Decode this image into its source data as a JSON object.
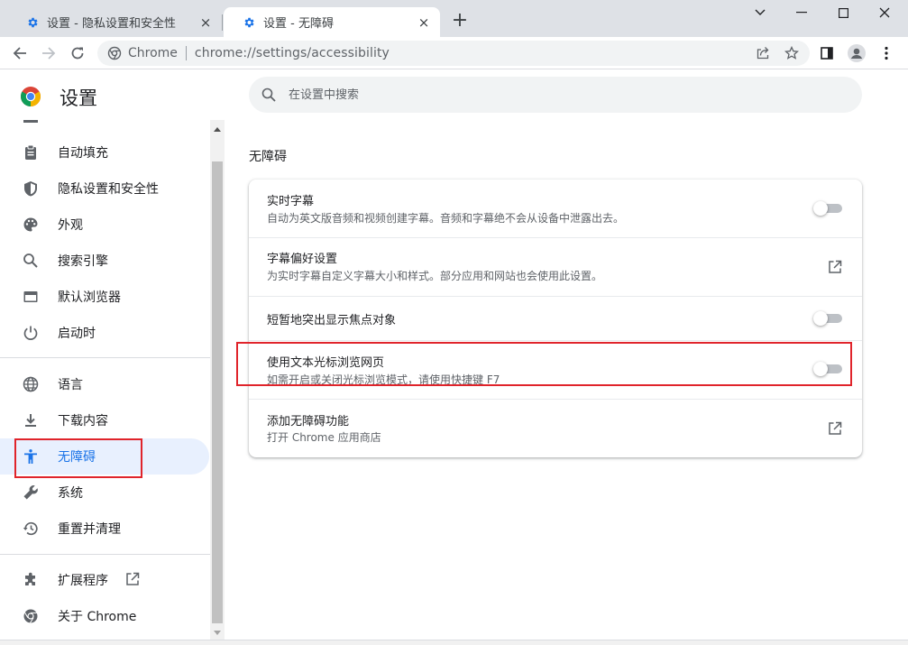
{
  "tabs": [
    {
      "title": "设置 - 隐私设置和安全性",
      "close": "×"
    },
    {
      "title": "设置 - 无障碍",
      "close": "×"
    }
  ],
  "new_tab": "+",
  "omnibox": {
    "chip": "Chrome",
    "url": "chrome://settings/accessibility"
  },
  "header": {
    "title": "设置",
    "search_placeholder": "在设置中搜索"
  },
  "sidebar": {
    "items": [
      {
        "label": "自动填充"
      },
      {
        "label": "隐私设置和安全性"
      },
      {
        "label": "外观"
      },
      {
        "label": "搜索引擎"
      },
      {
        "label": "默认浏览器"
      },
      {
        "label": "启动时"
      },
      {
        "label": "语言"
      },
      {
        "label": "下载内容"
      },
      {
        "label": "无障碍"
      },
      {
        "label": "系统"
      },
      {
        "label": "重置并清理"
      },
      {
        "label": "扩展程序"
      },
      {
        "label": "关于 Chrome"
      }
    ],
    "selected": "无障碍"
  },
  "main": {
    "section_title": "无障碍",
    "rows": [
      {
        "title": "实时字幕",
        "subtitle": "自动为英文版音频和视频创建字幕。音频和字幕绝不会从设备中泄露出去。",
        "toggle_on": false
      },
      {
        "title": "字幕偏好设置",
        "subtitle": "为实时字幕自定义字幕大小和样式。部分应用和网站也会使用此设置。"
      },
      {
        "title": "短暂地突出显示焦点对象",
        "toggle_on": false
      },
      {
        "title": "使用文本光标浏览网页",
        "subtitle": "如需开启或关闭光标浏览模式，请使用快捷键 F7",
        "toggle_on": false
      },
      {
        "title": "添加无障碍功能",
        "subtitle": "打开 Chrome 应用商店"
      }
    ]
  },
  "colors": {
    "accent": "#1a73e8",
    "highlight": "#e0242b",
    "selected_bg": "#e8f0fe"
  }
}
